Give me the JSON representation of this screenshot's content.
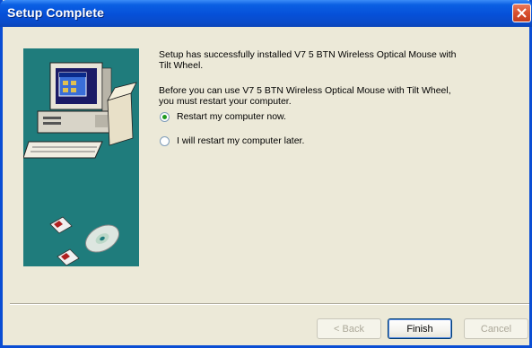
{
  "window": {
    "title": "Setup Complete"
  },
  "message": {
    "line1": "Setup has successfully installed V7 5 BTN Wireless Optical Mouse with Tilt Wheel.",
    "line2": "Before you can use V7 5 BTN Wireless Optical Mouse with Tilt Wheel, you must restart your computer."
  },
  "options": [
    {
      "label": "Restart my computer now.",
      "selected": true
    },
    {
      "label": "I will restart my computer later.",
      "selected": false
    }
  ],
  "buttons": {
    "back": "< Back",
    "finish": "Finish",
    "cancel": "Cancel"
  },
  "colors": {
    "titlebar": "#0650D8",
    "side_panel": "#1F7C7C",
    "dialog_bg": "#ECE9D8"
  }
}
